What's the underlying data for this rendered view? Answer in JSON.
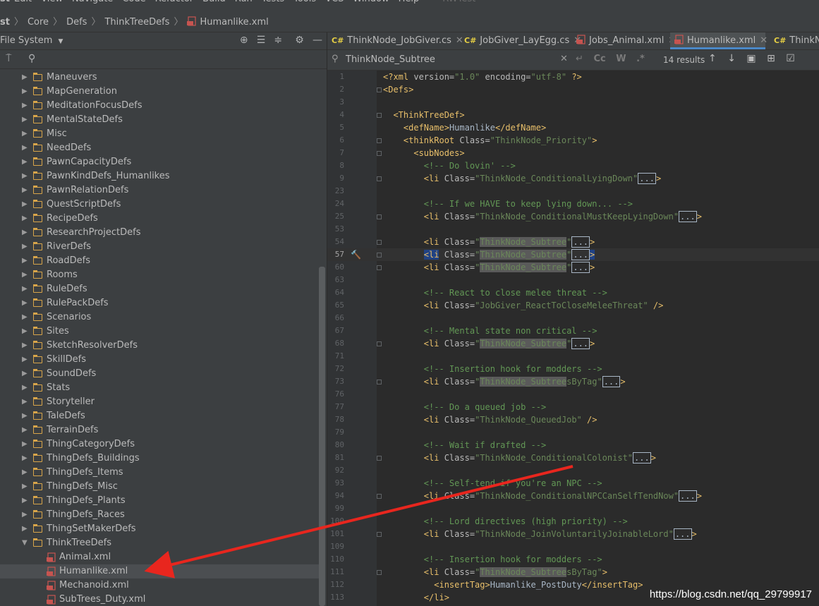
{
  "menubar": {
    "first": "st",
    "items": [
      "Edit",
      "View",
      "Navigate",
      "Code",
      "Refactor",
      "Build",
      "Run",
      "Tests",
      "Tools",
      "VCS",
      "Window",
      "Help"
    ],
    "project": "RWTest"
  },
  "breadcrumb": [
    "Core",
    "Defs",
    "ThinkTreeDefs",
    "Humanlike.xml"
  ],
  "left_panel": {
    "title": "File System",
    "folders": [
      "Maneuvers",
      "MapGeneration",
      "MeditationFocusDefs",
      "MentalStateDefs",
      "Misc",
      "NeedDefs",
      "PawnCapacityDefs",
      "PawnKindDefs_Humanlikes",
      "PawnRelationDefs",
      "QuestScriptDefs",
      "RecipeDefs",
      "ResearchProjectDefs",
      "RiverDefs",
      "RoadDefs",
      "Rooms",
      "RuleDefs",
      "RulePackDefs",
      "Scenarios",
      "Sites",
      "SketchResolverDefs",
      "SkillDefs",
      "SoundDefs",
      "Stats",
      "Storyteller",
      "TaleDefs",
      "TerrainDefs",
      "ThingCategoryDefs",
      "ThingDefs_Buildings",
      "ThingDefs_Items",
      "ThingDefs_Misc",
      "ThingDefs_Plants",
      "ThingDefs_Races",
      "ThingSetMakerDefs"
    ],
    "expanded_folder": "ThinkTreeDefs",
    "files": [
      "Animal.xml",
      "Humanlike.xml",
      "Mechanoid.xml",
      "SubTrees_Duty.xml"
    ],
    "selected_file": "Humanlike.xml"
  },
  "tabs": [
    {
      "label": "ThinkNode_JobGiver.cs",
      "kind": "cs"
    },
    {
      "label": "JobGiver_LayEgg.cs",
      "kind": "cs"
    },
    {
      "label": "Jobs_Animal.xml",
      "kind": "xml"
    },
    {
      "label": "Humanlike.xml",
      "kind": "xml",
      "active": true
    },
    {
      "label": "ThinkNo",
      "kind": "cs"
    }
  ],
  "search": {
    "query": "ThinkNode_Subtree",
    "results": "14 results",
    "opt_case": "Cc",
    "opt_word": "W",
    "opt_regex": ".*"
  },
  "code_lines": [
    {
      "n": "1",
      "h": "<span class=\"tag\">&lt;?xml </span><span class=\"attr\">version=</span><span class=\"val\">\"1.0\"</span><span class=\"attr\"> encoding=</span><span class=\"val\">\"utf-8\"</span><span class=\"tag\"> ?&gt;</span>"
    },
    {
      "n": "2",
      "h": "<span class=\"tag\">&lt;Defs&gt;</span>",
      "fold": true
    },
    {
      "n": "3",
      "h": ""
    },
    {
      "n": "4",
      "h": "  <span class=\"tag\">&lt;ThinkTreeDef&gt;</span>",
      "fold": true
    },
    {
      "n": "5",
      "h": "    <span class=\"tag\">&lt;defName&gt;</span><span class=\"txtc\">Humanlike</span><span class=\"tag\">&lt;/defName&gt;</span>"
    },
    {
      "n": "6",
      "h": "    <span class=\"tag\">&lt;thinkRoot </span><span class=\"attr\">Class=</span><span class=\"val\">\"ThinkNode_Priority\"</span><span class=\"tag\">&gt;</span>",
      "fold": true
    },
    {
      "n": "7",
      "h": "      <span class=\"tag\">&lt;subNodes&gt;</span>",
      "fold": true
    },
    {
      "n": "8",
      "h": "        <span class=\"cmt\">&lt;!-- Do lovin' --&gt;</span>"
    },
    {
      "n": "9",
      "h": "        <span class=\"tag\">&lt;li </span><span class=\"attr\">Class=</span><span class=\"val\">\"ThinkNode_ConditionalLyingDown\"</span><span class=\"coll\">...</span><span class=\"tag\">&gt;</span>",
      "fold": true
    },
    {
      "n": "23",
      "h": ""
    },
    {
      "n": "24",
      "h": "        <span class=\"cmt\">&lt;!-- If we HAVE to keep lying down... --&gt;</span>"
    },
    {
      "n": "25",
      "h": "        <span class=\"tag\">&lt;li </span><span class=\"attr\">Class=</span><span class=\"val\">\"ThinkNode_ConditionalMustKeepLyingDown\"</span><span class=\"coll\">...</span><span class=\"tag\">&gt;</span>",
      "fold": true
    },
    {
      "n": "53",
      "h": ""
    },
    {
      "n": "54",
      "h": "        <span class=\"tag\">&lt;li </span><span class=\"attr\">Class=</span><span class=\"val\">\"<span class=\"hl\">ThinkNode_Subtree</span>\"</span><span class=\"coll\">...</span><span class=\"tag\">&gt;</span>",
      "fold": true
    },
    {
      "n": "57",
      "h": "        <span class=\"tag\" style=\"background:#214283\">&lt;li</span><span class=\"attr\"> Class=</span><span class=\"val\">\"<span class=\"hl\">ThinkNode_Subtree</span>\"</span><span class=\"coll\">...</span><span class=\"tag\" style=\"background:#214283\">&gt;</span>",
      "fold": true,
      "cur": true
    },
    {
      "n": "60",
      "h": "        <span class=\"tag\">&lt;li </span><span class=\"attr\">Class=</span><span class=\"val\">\"<span class=\"hl\">ThinkNode_Subtree</span>\"</span><span class=\"coll\">...</span><span class=\"tag\">&gt;</span>",
      "fold": true
    },
    {
      "n": "63",
      "h": ""
    },
    {
      "n": "64",
      "h": "        <span class=\"cmt\">&lt;!-- React to close melee threat --&gt;</span>"
    },
    {
      "n": "65",
      "h": "        <span class=\"tag\">&lt;li </span><span class=\"attr\">Class=</span><span class=\"val\">\"JobGiver_ReactToCloseMeleeThreat\"</span><span class=\"tag\"> /&gt;</span>"
    },
    {
      "n": "66",
      "h": ""
    },
    {
      "n": "67",
      "h": "        <span class=\"cmt\">&lt;!-- Mental state non critical --&gt;</span>"
    },
    {
      "n": "68",
      "h": "        <span class=\"tag\">&lt;li </span><span class=\"attr\">Class=</span><span class=\"val\">\"<span class=\"hl\">ThinkNode_Subtree</span>\"</span><span class=\"coll\">...</span><span class=\"tag\">&gt;</span>",
      "fold": true
    },
    {
      "n": "71",
      "h": ""
    },
    {
      "n": "72",
      "h": "        <span class=\"cmt\">&lt;!-- Insertion hook for modders --&gt;</span>"
    },
    {
      "n": "73",
      "h": "        <span class=\"tag\">&lt;li </span><span class=\"attr\">Class=</span><span class=\"val\">\"<span class=\"hl\">ThinkNode_Subtree</span>sByTag\"</span><span class=\"coll\">...</span><span class=\"tag\">&gt;</span>",
      "fold": true
    },
    {
      "n": "76",
      "h": ""
    },
    {
      "n": "77",
      "h": "        <span class=\"cmt\">&lt;!-- Do a queued job --&gt;</span>"
    },
    {
      "n": "78",
      "h": "        <span class=\"tag\">&lt;li </span><span class=\"attr\">Class=</span><span class=\"val\">\"ThinkNode_QueuedJob\"</span><span class=\"tag\"> /&gt;</span>"
    },
    {
      "n": "79",
      "h": ""
    },
    {
      "n": "80",
      "h": "        <span class=\"cmt\">&lt;!-- Wait if drafted --&gt;</span>"
    },
    {
      "n": "81",
      "h": "        <span class=\"tag\">&lt;li </span><span class=\"attr\">Class=</span><span class=\"val\">\"ThinkNode_ConditionalColonist\"</span><span class=\"coll\">...</span><span class=\"tag\">&gt;</span>",
      "fold": true
    },
    {
      "n": "92",
      "h": ""
    },
    {
      "n": "93",
      "h": "        <span class=\"cmt\">&lt;!-- Self-tend if you're an NPC --&gt;</span>"
    },
    {
      "n": "94",
      "h": "        <span class=\"tag\">&lt;li </span><span class=\"attr\">Class=</span><span class=\"val\">\"ThinkNode_ConditionalNPCCanSelfTendNow\"</span><span class=\"coll\">...</span><span class=\"tag\">&gt;</span>",
      "fold": true
    },
    {
      "n": "99",
      "h": ""
    },
    {
      "n": "100",
      "h": "        <span class=\"cmt\">&lt;!-- Lord directives (high priority) --&gt;</span>"
    },
    {
      "n": "101",
      "h": "        <span class=\"tag\">&lt;li </span><span class=\"attr\">Class=</span><span class=\"val\">\"ThinkNode_JoinVoluntarilyJoinableLord\"</span><span class=\"coll\">...</span><span class=\"tag\">&gt;</span>",
      "fold": true
    },
    {
      "n": "109",
      "h": ""
    },
    {
      "n": "110",
      "h": "        <span class=\"cmt\">&lt;!-- Insertion hook for modders --&gt;</span>"
    },
    {
      "n": "111",
      "h": "        <span class=\"tag\">&lt;li </span><span class=\"attr\">Class=</span><span class=\"val\">\"<span class=\"hl\">ThinkNode_Subtree</span>sByTag\"</span><span class=\"tag\">&gt;</span>",
      "fold": true
    },
    {
      "n": "112",
      "h": "          <span class=\"tag\">&lt;insertTag&gt;</span><span class=\"txtc\">Humanlike_PostDuty</span><span class=\"tag\">&lt;/insertTag&gt;</span>"
    },
    {
      "n": "113",
      "h": "        <span class=\"tag\">&lt;/li&gt;</span>"
    }
  ],
  "watermark": "https://blog.csdn.net/qq_29799917",
  "colors": {
    "annotation_arrow": "#e8261e",
    "accent": "#4a88c7"
  }
}
